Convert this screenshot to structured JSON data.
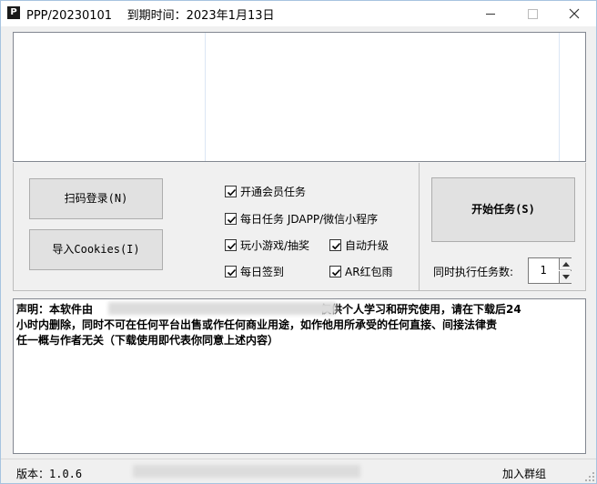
{
  "window": {
    "app_icon": "P",
    "title": "PPP/20230101    到期时间：2023年1月13日",
    "icons": {
      "minimize": "minimize-icon",
      "maximize": "maximize-icon",
      "close": "close-icon"
    }
  },
  "buttons": {
    "scan_login": "扫码登录(N)",
    "import_cookies": "导入Cookies(I)",
    "start_task": "开始任务(S)"
  },
  "checkboxes": [
    {
      "label": "开通会员任务",
      "checked": true
    },
    {
      "label": "每日任务 JDAPP/微信小程序",
      "checked": true
    },
    {
      "label": "玩小游戏/抽奖",
      "checked": true
    },
    {
      "label": "自动升级",
      "checked": true
    },
    {
      "label": "每日签到",
      "checked": true
    },
    {
      "label": "AR红包雨",
      "checked": true
    }
  ],
  "concurrency": {
    "label": "同时执行任务数:",
    "value": "1"
  },
  "disclaimer": {
    "line1_prefix": "声明：本软件由",
    "line1_suffix": "仅供个人学习和研究使用，请在下载后24",
    "line2": "小时内删除，同时不可在任何平台出售或作任何商业用途，如作他用所承受的任何直接、间接法律责",
    "line3": "任一概与作者无关（下载使用即代表你同意上述内容）"
  },
  "status": {
    "version": "版本：1.0.6",
    "join_group": "加入群组"
  },
  "colors": {
    "window_border": "#a7c4e0",
    "panel_bg": "#f0f0f0",
    "button_bg": "#e1e1e1"
  }
}
